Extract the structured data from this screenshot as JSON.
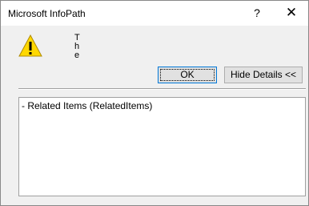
{
  "window": {
    "title": "Microsoft InfoPath",
    "help_label": "?",
    "close_label": "✕"
  },
  "message": {
    "text": "The"
  },
  "icons": {
    "warning": "warning-triangle-icon"
  },
  "buttons": {
    "ok_label": "OK",
    "hide_details_label": "Hide Details <<"
  },
  "details": {
    "text": "- Related Items (RelatedItems)"
  },
  "colors": {
    "accent": "#0078d7",
    "warning_yellow": "#ffd800"
  }
}
